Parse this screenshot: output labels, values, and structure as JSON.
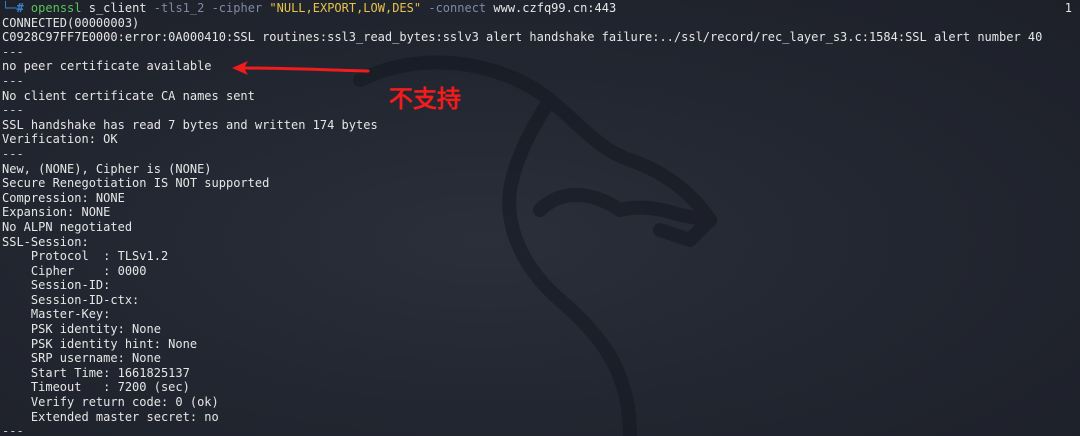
{
  "command": {
    "prompt_corner": "└─",
    "prompt_hash": "#",
    "program": "openssl",
    "subcommand": "s_client",
    "flag_tls": "-tls1_2",
    "flag_cipher": "-cipher",
    "cipher_value": "\"NULL,EXPORT,LOW,DES\"",
    "flag_connect": "-connect",
    "host": "www.czfq99.cn:443",
    "line_number": "1"
  },
  "output": {
    "connected": "CONNECTED(00000003)",
    "error": "C0928C97FF7E0000:error:0A000410:SSL routines:ssl3_read_bytes:sslv3 alert handshake failure:../ssl/record/rec_layer_s3.c:1584:SSL alert number 40",
    "sep": "---",
    "no_peer_cert": "no peer certificate available",
    "no_client_ca": "No client certificate CA names sent",
    "handshake_read": "SSL handshake has read 7 bytes and written 174 bytes",
    "verification": "Verification: OK",
    "new_cipher": "New, (NONE), Cipher is (NONE)",
    "renegotiation": "Secure Renegotiation IS NOT supported",
    "compression": "Compression: NONE",
    "expansion": "Expansion: NONE",
    "alpn": "No ALPN negotiated",
    "ssl_session": "SSL-Session:",
    "protocol": "    Protocol  : TLSv1.2",
    "cipher": "    Cipher    : 0000",
    "session_id": "    Session-ID:",
    "session_id_ctx": "    Session-ID-ctx:",
    "master_key": "    Master-Key:",
    "psk_identity": "    PSK identity: None",
    "psk_identity_hint": "    PSK identity hint: None",
    "srp_username": "    SRP username: None",
    "start_time": "    Start Time: 1661825137",
    "timeout": "    Timeout   : 7200 (sec)",
    "verify_return": "    Verify return code: 0 (ok)",
    "extended_master": "    Extended master secret: no",
    "trailing_sep": "---"
  },
  "annotation": {
    "text": "不支持",
    "color": "#f21c1c"
  },
  "colors": {
    "background": "#1f232c",
    "prompt": "#3b82d4",
    "command": "#58c45a",
    "flag": "#7f8aa3",
    "string": "#e7c34a",
    "text": "#e6e6e6"
  }
}
